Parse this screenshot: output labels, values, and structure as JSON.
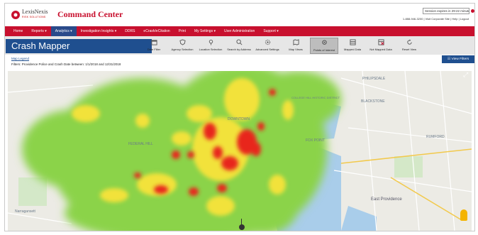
{
  "brand": {
    "name": "LexisNexis",
    "sub": "RISK SOLUTIONS",
    "app_title": "Command Center",
    "colors": {
      "brand_red": "#c8102e",
      "nav_blue": "#1f4f8f",
      "active_nav": "#2a4a8a"
    }
  },
  "session": {
    "notice": "Session expires in 29:22 minutes",
    "contact": "1-888-946-3200 | Visit Corporate Site | Help | Logout"
  },
  "nav": {
    "items": [
      {
        "label": "Home"
      },
      {
        "label": "Reports ▾"
      },
      {
        "label": "Analytics ▾"
      },
      {
        "label": "Investigation Insights ▾"
      },
      {
        "label": "DDRS"
      },
      {
        "label": "eCrash/eCitation"
      },
      {
        "label": "Print"
      },
      {
        "label": "My Settings ▾"
      },
      {
        "label": "User Administration"
      },
      {
        "label": "Support ▾"
      }
    ],
    "active_index": 2
  },
  "page": {
    "title": "Crash Mapper",
    "map_legend_link": "Map Legend",
    "filters_text": "Filters: Providence Police and Crash Date between: 1/1/2018 and 12/31/2018",
    "view_filters_button": "View Filters"
  },
  "toolbar": {
    "tools": [
      {
        "label": "Date Filter",
        "icon": "calendar-icon"
      },
      {
        "label": "Agency Selection",
        "icon": "shield-icon"
      },
      {
        "label": "Location Selection",
        "icon": "map-pin-icon"
      },
      {
        "label": "Search by Address",
        "icon": "search-icon"
      },
      {
        "label": "Advanced Settings",
        "icon": "gear-icon"
      },
      {
        "label": "Map Views",
        "icon": "map-icon"
      },
      {
        "label": "Points of Interest",
        "icon": "poi-icon"
      },
      {
        "label": "Mapped Data",
        "icon": "table-icon"
      },
      {
        "label": "Not Mapped Data",
        "icon": "table-x-icon"
      },
      {
        "label": "Reset View",
        "icon": "reset-icon"
      }
    ],
    "active_index": 6
  },
  "map": {
    "labels": {
      "federal_hill": "FEDERAL HILL",
      "downtown": "DOWNTOWN",
      "college_hill": "COLLEGE HILL HISTORIC DISTRICT",
      "fox_point": "FOX POINT",
      "philipsdale": "PHILIPSDALE",
      "blackstone": "BLACKSTONE",
      "east_providence": "East Providence",
      "rumford": "RUMFORD",
      "cranston": "Narragansett"
    }
  }
}
